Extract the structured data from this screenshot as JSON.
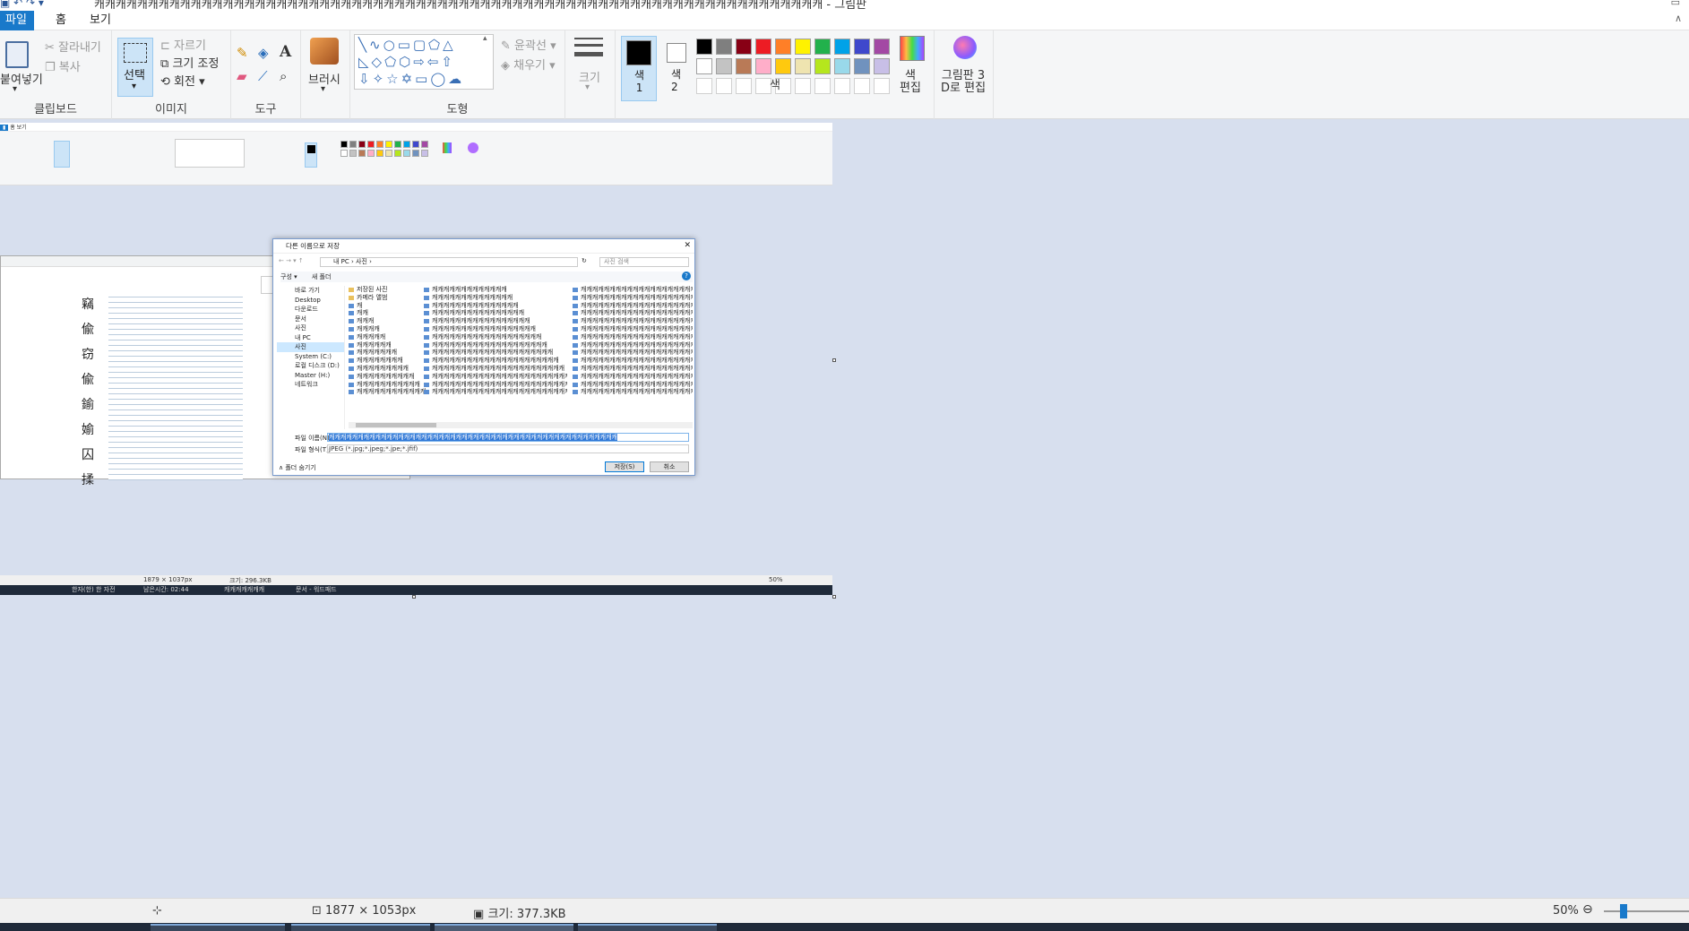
{
  "window": {
    "title": "캐캐캐캐캐캐캐캐캐캐캐캐캐캐캐캐캐캐캐캐캐캐캐캐캐캐캐캐캐캐캐캐캐캐캐캐캐캐캐캐캐캐캐캐캐캐캐캐캐캐캐캐캐캐캐캐캐캐캐캐캐캐캐캐캐캐캐캐 - 그림판"
  },
  "menu": {
    "file": "파일",
    "home": "홈",
    "view": "보기"
  },
  "ribbon": {
    "clipboard": {
      "label": "클립보드",
      "paste": "붙여넣기",
      "cut": "잘라내기",
      "copy": "복사"
    },
    "image": {
      "label": "이미지",
      "select": "선택",
      "crop": "자르기",
      "resize": "크기 조정",
      "rotate": "회전"
    },
    "tools": {
      "label": "도구"
    },
    "brush": {
      "label": "브러시"
    },
    "shapes": {
      "label": "도형",
      "outline": "윤곽선",
      "fill": "채우기"
    },
    "size": {
      "label": "크기"
    },
    "color1": "색\n1",
    "color2": "색\n2",
    "colors": {
      "label": "색",
      "edit": "색\n편집"
    },
    "paint3d": "그림판 3\nD로 편집"
  },
  "palette_row1": [
    "#000000",
    "#7f7f7f",
    "#880015",
    "#ed1c24",
    "#ff7f27",
    "#fff200",
    "#22b14c",
    "#00a2e8",
    "#3f48cc",
    "#a349a4"
  ],
  "palette_row2": [
    "#ffffff",
    "#c3c3c3",
    "#b97a57",
    "#ffaec9",
    "#ffc90e",
    "#efe4b0",
    "#b5e61d",
    "#99d9ea",
    "#7092be",
    "#c8bfe7"
  ],
  "status": {
    "dimensions": "1877 × 1053px",
    "size": "크기: 377.3KB",
    "zoom": "50%"
  },
  "nested": {
    "status_dims": "1879 × 1037px",
    "status_size": "크기: 296.3KB",
    "zoom": "50%",
    "taskbar": [
      "한자(한) 한 자전",
      "남은시간: 02:44",
      "캐캐캐캐캐캐캐",
      "문서 - 워드패드"
    ],
    "dialog": {
      "title": "다른 이름으로 저장",
      "address": "내 PC  ›  사진  ›",
      "search": "사진 검색",
      "organize": "구성 ▾",
      "new_folder": "새 폴더",
      "nav": [
        "바로 가기",
        "Desktop",
        "다운로드",
        "문서",
        "사진",
        "내 PC",
        "사진",
        "System (C:)",
        "로컬 디스크 (D:)",
        "Master (H:)",
        "네트워크"
      ],
      "col1": [
        "저장된 사진",
        "카메라 앨범",
        "캐",
        "캐캐",
        "캐캐캐",
        "캐캐캐캐",
        "캐캐캐캐캐",
        "캐캐캐캐캐캐",
        "캐캐캐캐캐캐캐",
        "캐캐캐캐캐캐캐캐",
        "캐캐캐캐캐캐캐캐캐",
        "캐캐캐캐캐캐캐캐캐캐",
        "캐캐캐캐캐캐캐캐캐캐캐",
        "캐캐캐캐캐캐캐캐캐캐캐캐"
      ],
      "col2": [
        "캐캐캐캐캐캐캐캐캐캐캐캐캐",
        "캐캐캐캐캐캐캐캐캐캐캐캐캐캐",
        "캐캐캐캐캐캐캐캐캐캐캐캐캐캐캐",
        "캐캐캐캐캐캐캐캐캐캐캐캐캐캐캐캐",
        "캐캐캐캐캐캐캐캐캐캐캐캐캐캐캐캐캐",
        "캐캐캐캐캐캐캐캐캐캐캐캐캐캐캐캐캐캐",
        "캐캐캐캐캐캐캐캐캐캐캐캐캐캐캐캐캐캐캐",
        "캐캐캐캐캐캐캐캐캐캐캐캐캐캐캐캐캐캐캐캐",
        "캐캐캐캐캐캐캐캐캐캐캐캐캐캐캐캐캐캐캐캐캐",
        "캐캐캐캐캐캐캐캐캐캐캐캐캐캐캐캐캐캐캐캐캐캐",
        "캐캐캐캐캐캐캐캐캐캐캐캐캐캐캐캐캐캐캐캐캐캐캐",
        "캐캐캐캐캐캐캐캐캐캐캐캐캐캐캐캐캐캐캐캐캐캐캐캐",
        "캐캐캐캐캐캐캐캐캐캐캐캐캐캐캐캐캐캐캐캐캐캐캐캐캐",
        "캐캐캐캐캐캐캐캐캐캐캐캐캐캐캐캐캐캐캐캐캐캐캐캐캐캐"
      ],
      "col3": [
        "캐캐캐캐캐캐캐캐캐캐캐캐캐캐캐캐캐캐캐캐캐캐",
        "캐캐캐캐캐캐캐캐캐캐캐캐캐캐캐캐캐캐캐캐캐캐",
        "캐캐캐캐캐캐캐캐캐캐캐캐캐캐캐캐캐캐캐캐캐캐",
        "캐캐캐캐캐캐캐캐캐캐캐캐캐캐캐캐캐캐캐캐캐캐",
        "캐캐캐캐캐캐캐캐캐캐캐캐캐캐캐캐캐캐캐캐캐캐",
        "캐캐캐캐캐캐캐캐캐캐캐캐캐캐캐캐캐캐캐캐캐캐",
        "캐캐캐캐캐캐캐캐캐캐캐캐캐캐캐캐캐캐캐캐캐캐",
        "캐캐캐캐캐캐캐캐캐캐캐캐캐캐캐캐캐캐캐캐캐캐",
        "캐캐캐캐캐캐캐캐캐캐캐캐캐캐캐캐캐캐캐캐캐캐",
        "캐캐캐캐캐캐캐캐캐캐캐캐캐캐캐캐캐캐캐캐캐캐",
        "캐캐캐캐캐캐캐캐캐캐캐캐캐캐캐캐캐캐캐캐캐캐",
        "캐캐캐캐캐캐캐캐캐캐캐캐캐캐캐캐캐캐캐캐캐캐",
        "캐캐캐캐캐캐캐캐캐캐캐캐캐캐캐캐캐캐캐캐캐캐",
        "캐캐캐캐캐캐캐캐캐캐캐캐캐캐캐캐캐캐캐캐캐캐"
      ],
      "filename_label": "파일 이름(N):",
      "filename": "캐캐캐캐캐캐캐캐캐캐캐캐캐캐캐캐캐캐캐캐캐캐캐캐캐캐캐캐캐캐캐캐캐캐캐캐캐캐캐캐캐캐캐캐캐캐캐캐캐캐",
      "filetype_label": "파일 형식(T):",
      "filetype": "JPEG (*.jpg;*.jpeg;*.jpe;*.jfif)",
      "hide_folders": "∧ 폴더 숨기기",
      "save": "저장(S)",
      "cancel": "취소"
    }
  }
}
